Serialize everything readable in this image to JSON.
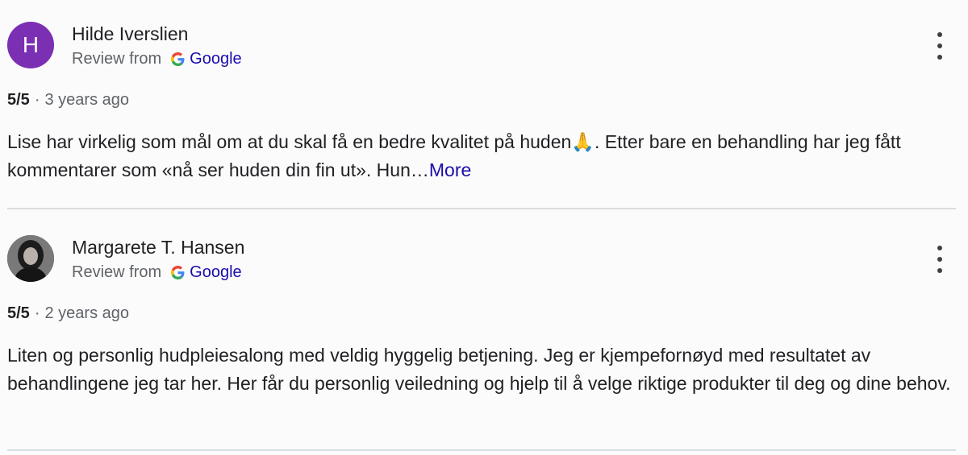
{
  "reviews": [
    {
      "author": "Hilde Iverslien",
      "avatar_letter": "H",
      "source_prefix": "Review from",
      "source_name": "Google",
      "rating": "5/5",
      "separator": "·",
      "time": "3 years ago",
      "text": "Lise har virkelig som mål om at du skal få en bedre kvalitet på huden🙏. Etter bare en behandling har jeg fått kommentarer som «nå ser huden din fin ut». Hun…",
      "more_label": "More"
    },
    {
      "author": "Margarete T. Hansen",
      "source_prefix": "Review from",
      "source_name": "Google",
      "rating": "5/5",
      "separator": "·",
      "time": "2 years ago",
      "text": "Liten og personlig hudpleiesalong med veldig hyggelig betjening. Jeg er kjempefornøyd med resultatet av behandlingene jeg tar her. Her får du personlig veiledning og hjelp til å velge riktige produkter til deg og dine behov."
    }
  ],
  "colors": {
    "avatar_purple": "#7b2fb3",
    "link_blue": "#1a0dab",
    "meta_gray": "#5f6368",
    "divider": "#dadce0"
  },
  "icons": {
    "menu": "more-vert-icon",
    "source": "google-g-icon"
  }
}
